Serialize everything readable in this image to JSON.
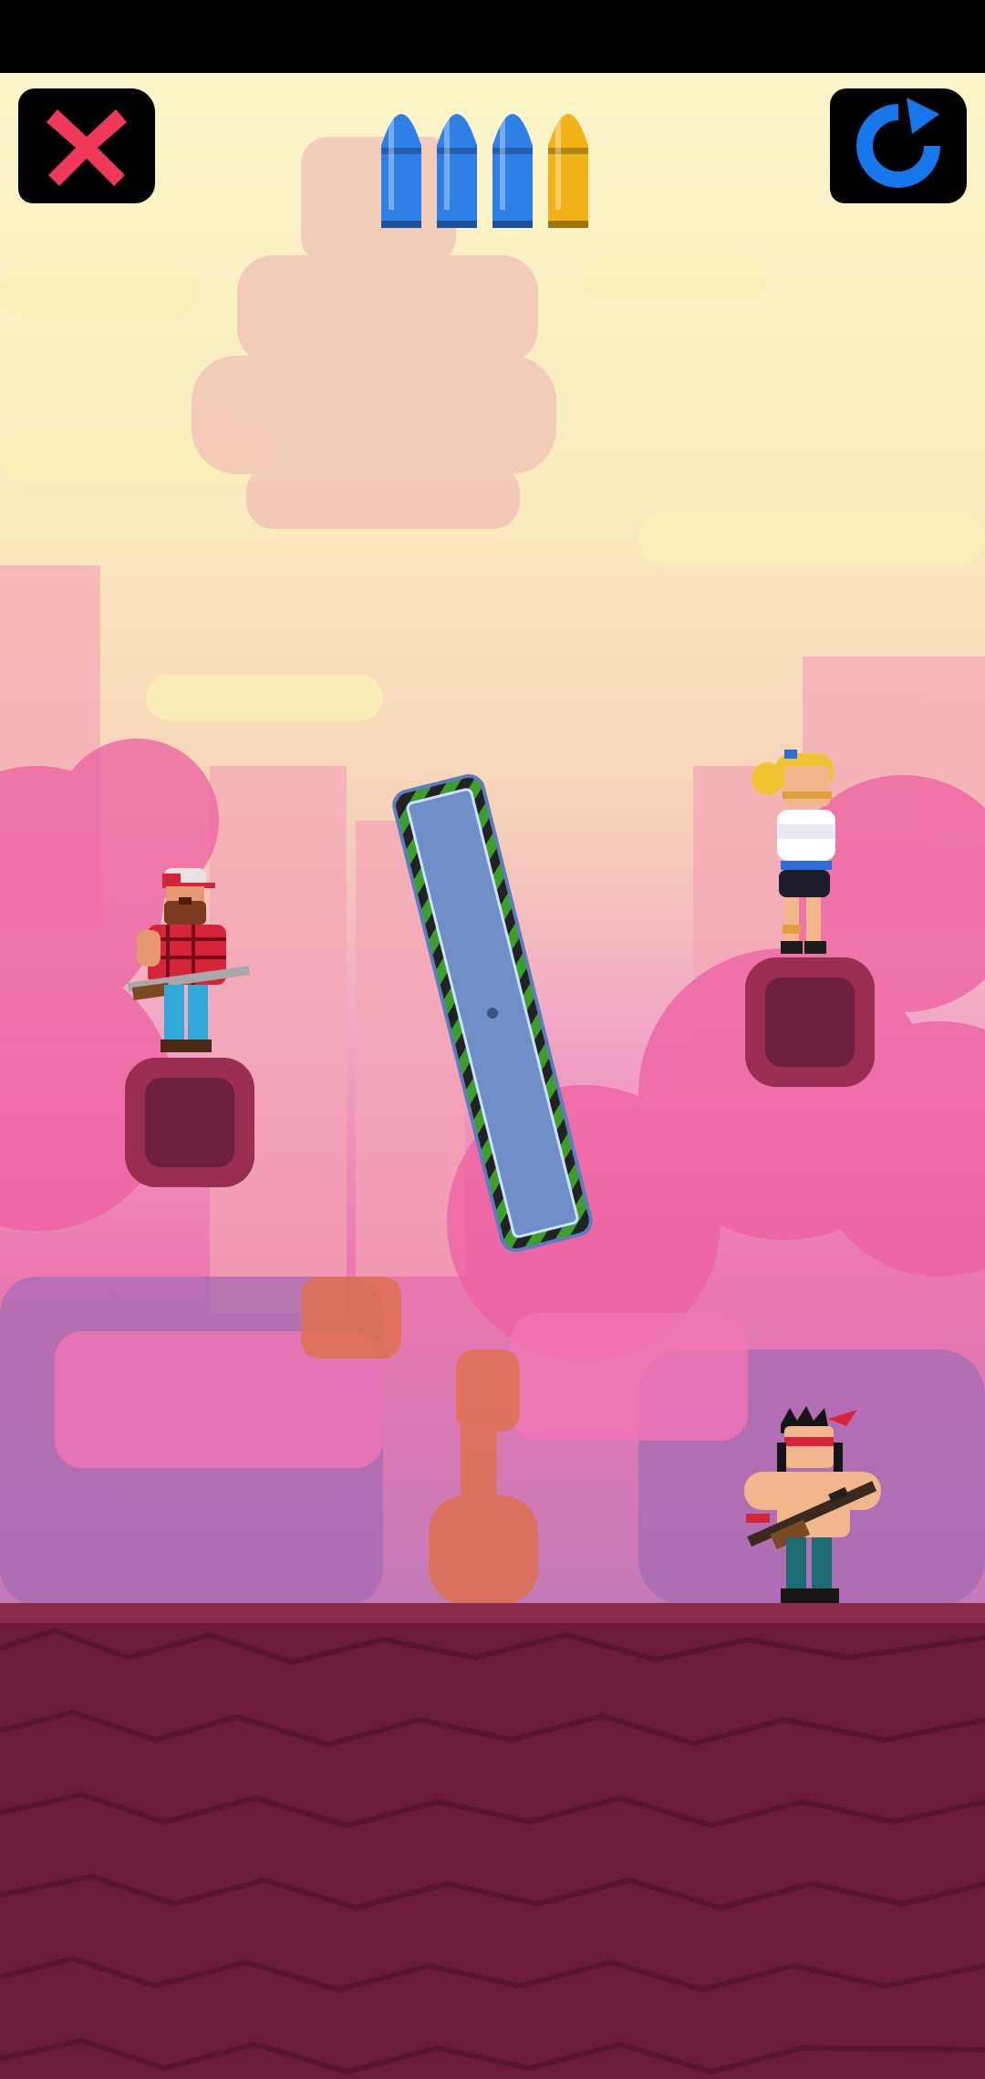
{
  "hud": {
    "close_icon": "close-x-icon",
    "restart_icon": "restart-arrow-icon",
    "ammo": [
      {
        "type": "standard-bullet",
        "color": "#2f7fe8"
      },
      {
        "type": "standard-bullet",
        "color": "#2f7fe8"
      },
      {
        "type": "standard-bullet",
        "color": "#2f7fe8"
      },
      {
        "type": "gold-bullet",
        "color": "#f2b21a"
      }
    ]
  },
  "colors": {
    "close_x": "#f0385a",
    "restart_arrow": "#1677ea",
    "ground": "#6c1b3b",
    "platform": "#9a2d52",
    "plank_fill": "#6f8fc8",
    "plank_stripe_a": "#3d9e2a",
    "plank_stripe_b": "#222222"
  },
  "scene": {
    "characters": [
      {
        "name": "lumberjack-enemy",
        "role": "enemy"
      },
      {
        "name": "blonde-hostage",
        "role": "hostage"
      },
      {
        "name": "commando-player",
        "role": "player"
      }
    ],
    "obstacles": [
      {
        "name": "rotating-plank"
      },
      {
        "name": "left-platform"
      },
      {
        "name": "right-platform"
      }
    ]
  }
}
